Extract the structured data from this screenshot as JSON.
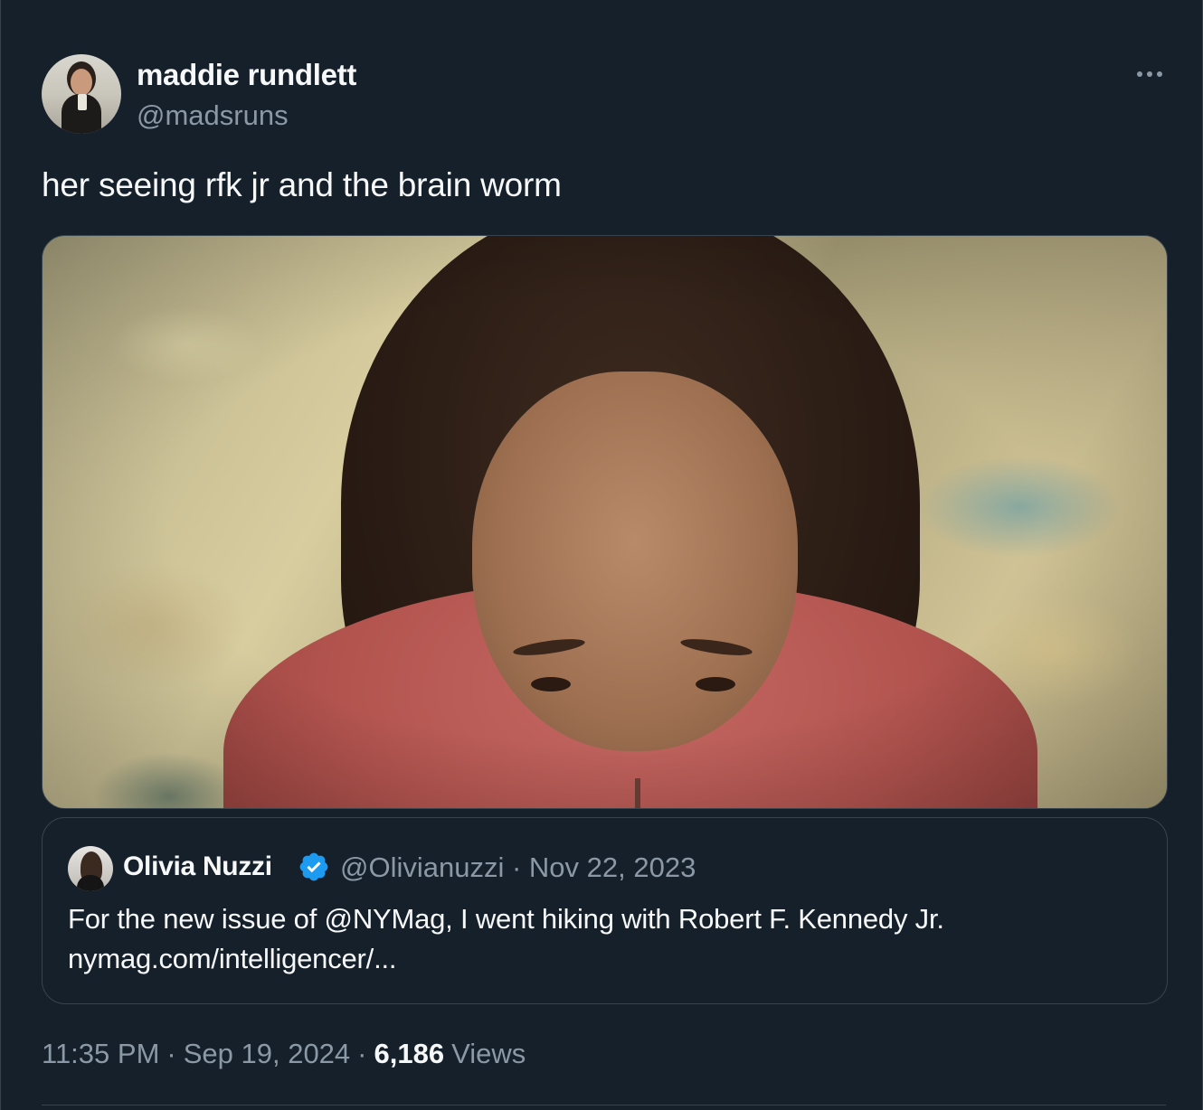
{
  "tweet": {
    "display_name": "maddie rundlett",
    "handle": "@madsruns",
    "text": "her seeing rfk jr and the brain worm",
    "time": "11:35 PM",
    "date": "Sep 19, 2024",
    "views_count": "6,186",
    "views_label": "Views",
    "separator": "·"
  },
  "quote": {
    "display_name": "Olivia Nuzzi",
    "handle": "@Olivianuzzi",
    "date": "Nov 22, 2023",
    "meta": "@Olivianuzzi · Nov 22, 2023",
    "text_line1": "For the new issue of @NYMag, I went hiking with Robert F. Kennedy Jr.",
    "text_line2": "nymag.com/intelligencer/...",
    "verified": true
  },
  "icons": {
    "more": "more-horizontal-icon",
    "verified": "verified-badge-icon"
  },
  "colors": {
    "background": "#15202b",
    "border": "#38444d",
    "text_primary": "#f7f9f9",
    "text_secondary": "#8b98a5",
    "verified_blue": "#1d9bf0"
  }
}
